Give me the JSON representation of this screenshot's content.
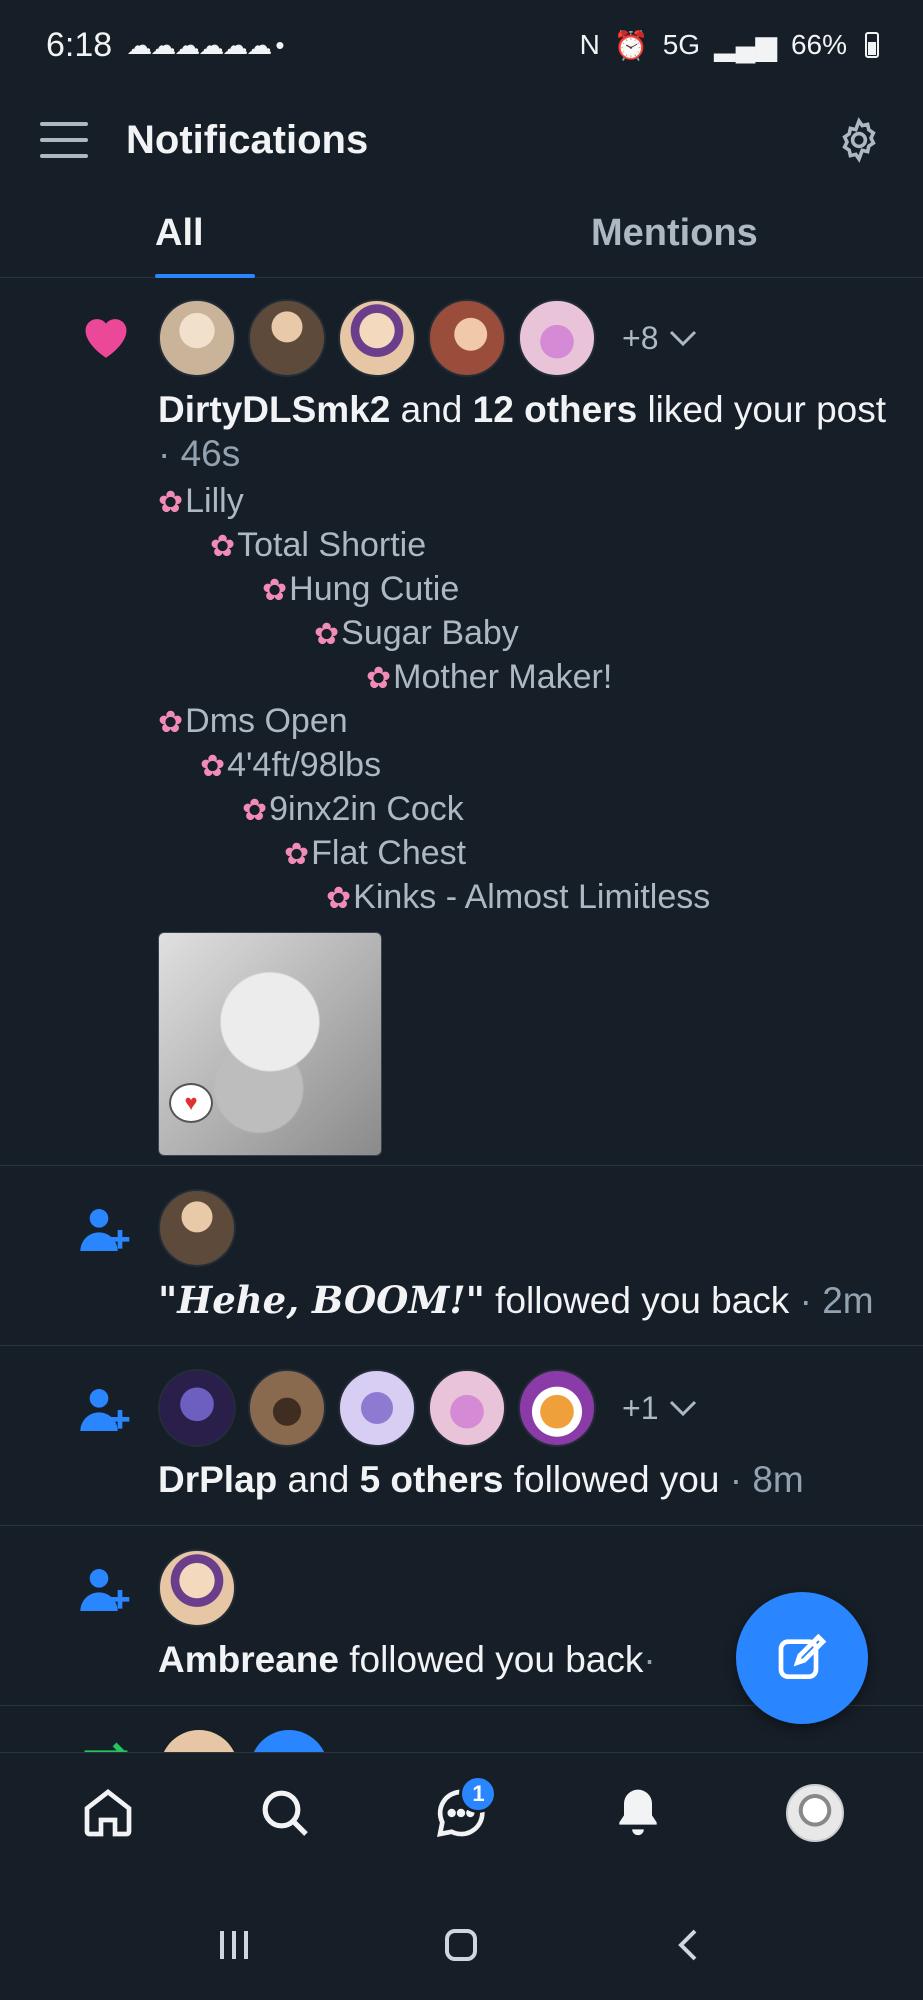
{
  "status_bar": {
    "time": "6:18",
    "notification_icons": "☁☁☁☁☁☁ •",
    "network": "5G",
    "battery": "66%"
  },
  "header": {
    "title": "Notifications"
  },
  "tabs": [
    {
      "label": "All",
      "active": true
    },
    {
      "label": "Mentions",
      "active": false
    }
  ],
  "notifications": [
    {
      "type": "like",
      "icon": "heart-icon",
      "avatar_colors": [
        "#c9b49a",
        "#5d4a3b",
        "#e7c6a5",
        "#9a4d3a",
        "#cfa3c8"
      ],
      "more_count": "+8",
      "actor": "DirtyDLSmk2",
      "connector": " and ",
      "others": "12 others",
      "action": " liked your post",
      "time": "46s",
      "bio_lines": [
        "Lilly",
        "Total Shortie",
        "Hung Cutie",
        "Sugar Baby",
        "Mother Maker!",
        "Dms Open",
        "4'4ft/98lbs",
        "9inx2in Cock",
        "Flat Chest",
        "Kinks - Almost Limitless"
      ]
    },
    {
      "type": "follow",
      "icon": "person-add-icon",
      "avatar_colors": [
        "#5d4a3b"
      ],
      "actor": "\"Hehe, BOOM!\"",
      "action": " followed you back",
      "time": "2m"
    },
    {
      "type": "follow",
      "icon": "person-add-icon",
      "avatar_colors": [
        "#4a3c7a",
        "#6b5440",
        "#b6a6e6",
        "#cfa3c8",
        "#e09a5a"
      ],
      "more_count": "+1",
      "actor": "DrPlap",
      "connector": " and ",
      "others": "5 others",
      "action": " followed you",
      "time": "8m"
    },
    {
      "type": "follow",
      "icon": "person-add-icon",
      "avatar_colors": [
        "#e7c6a5"
      ],
      "actor": "Ambreane",
      "action": " followed you back",
      "time": "·"
    }
  ],
  "bottom_nav": {
    "items": [
      "home-icon",
      "search-icon",
      "messages-icon",
      "bell-icon",
      "profile-avatar"
    ],
    "messages_badge": "1"
  },
  "colors": {
    "background": "#161e27",
    "accent": "#2a86ff",
    "heart": "#ec4899",
    "muted_text": "#93a2b1"
  }
}
